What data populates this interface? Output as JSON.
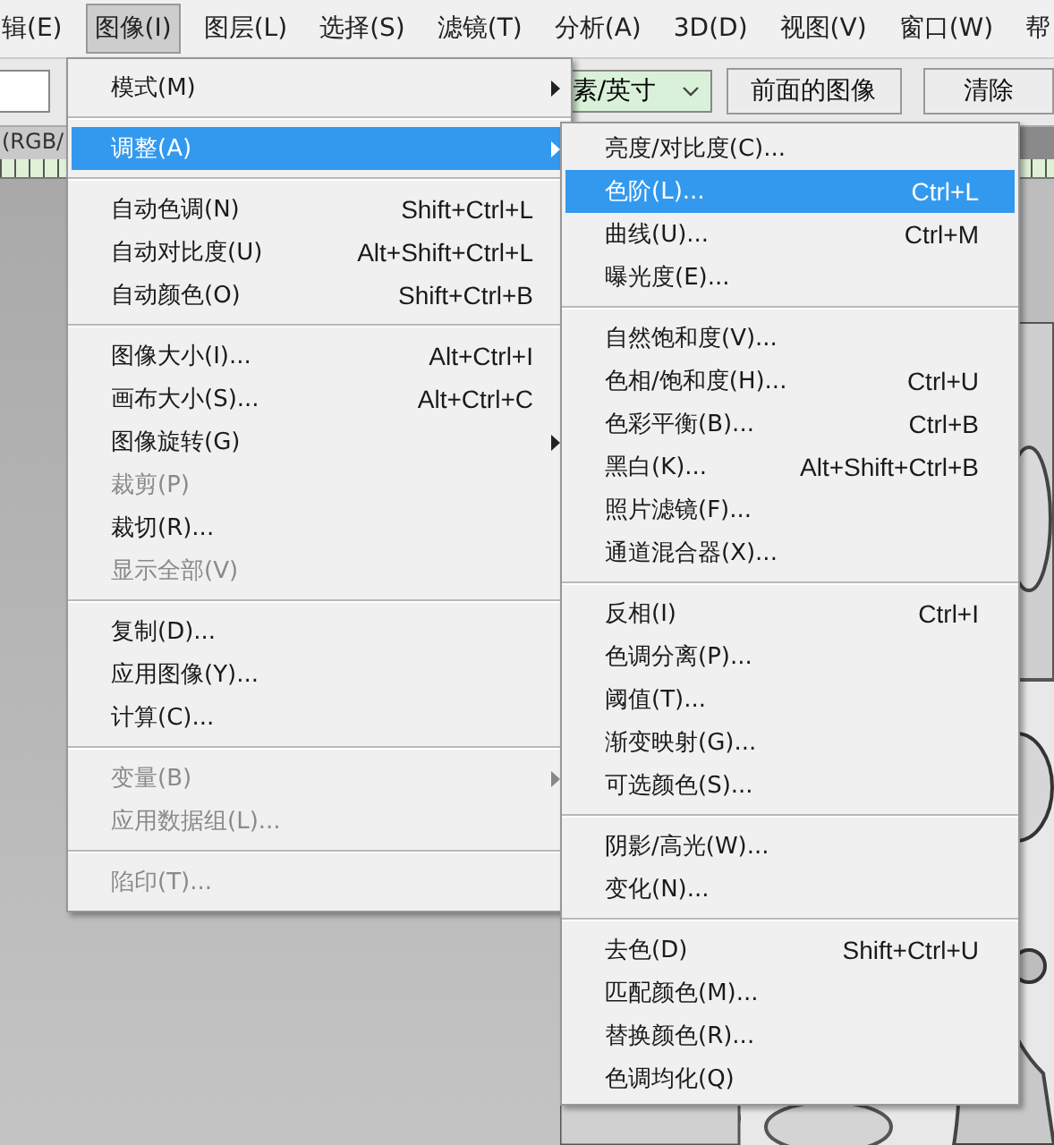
{
  "menubar": [
    {
      "label": "辑(E)",
      "selected": false
    },
    {
      "label": "图像(I)",
      "selected": true
    },
    {
      "label": "图层(L)",
      "selected": false
    },
    {
      "label": "选择(S)",
      "selected": false
    },
    {
      "label": "滤镜(T)",
      "selected": false
    },
    {
      "label": "分析(A)",
      "selected": false
    },
    {
      "label": "3D(D)",
      "selected": false
    },
    {
      "label": "视图(V)",
      "selected": false
    },
    {
      "label": "窗口(W)",
      "selected": false
    },
    {
      "label": "帮",
      "selected": false
    }
  ],
  "toolbar": {
    "units_select": "素/英寸",
    "buttons": [
      "前面的图像",
      "清除"
    ]
  },
  "document_tab": "(RGB/",
  "image_menu": [
    {
      "kind": "item",
      "label": "模式(M)",
      "has_submenu": true,
      "disabled": false,
      "selected": false
    },
    {
      "kind": "separator"
    },
    {
      "kind": "item",
      "label": "调整(A)",
      "has_submenu": true,
      "disabled": false,
      "selected": true
    },
    {
      "kind": "separator"
    },
    {
      "kind": "item",
      "label": "自动色调(N)",
      "shortcut": "Shift+Ctrl+L",
      "has_submenu": false,
      "disabled": false,
      "selected": false
    },
    {
      "kind": "item",
      "label": "自动对比度(U)",
      "shortcut": "Alt+Shift+Ctrl+L",
      "has_submenu": false,
      "disabled": false,
      "selected": false
    },
    {
      "kind": "item",
      "label": "自动颜色(O)",
      "shortcut": "Shift+Ctrl+B",
      "has_submenu": false,
      "disabled": false,
      "selected": false
    },
    {
      "kind": "separator"
    },
    {
      "kind": "item",
      "label": "图像大小(I)...",
      "shortcut": "Alt+Ctrl+I",
      "has_submenu": false,
      "disabled": false,
      "selected": false
    },
    {
      "kind": "item",
      "label": "画布大小(S)...",
      "shortcut": "Alt+Ctrl+C",
      "has_submenu": false,
      "disabled": false,
      "selected": false
    },
    {
      "kind": "item",
      "label": "图像旋转(G)",
      "has_submenu": true,
      "disabled": false,
      "selected": false
    },
    {
      "kind": "item",
      "label": "裁剪(P)",
      "has_submenu": false,
      "disabled": true,
      "selected": false
    },
    {
      "kind": "item",
      "label": "裁切(R)...",
      "has_submenu": false,
      "disabled": false,
      "selected": false
    },
    {
      "kind": "item",
      "label": "显示全部(V)",
      "has_submenu": false,
      "disabled": true,
      "selected": false
    },
    {
      "kind": "separator"
    },
    {
      "kind": "item",
      "label": "复制(D)...",
      "has_submenu": false,
      "disabled": false,
      "selected": false
    },
    {
      "kind": "item",
      "label": "应用图像(Y)...",
      "has_submenu": false,
      "disabled": false,
      "selected": false
    },
    {
      "kind": "item",
      "label": "计算(C)...",
      "has_submenu": false,
      "disabled": false,
      "selected": false
    },
    {
      "kind": "separator"
    },
    {
      "kind": "item",
      "label": "变量(B)",
      "has_submenu": true,
      "disabled": true,
      "selected": false
    },
    {
      "kind": "item",
      "label": "应用数据组(L)...",
      "has_submenu": false,
      "disabled": true,
      "selected": false
    },
    {
      "kind": "separator"
    },
    {
      "kind": "item",
      "label": "陷印(T)...",
      "has_submenu": false,
      "disabled": true,
      "selected": false
    }
  ],
  "adjust_submenu": [
    {
      "kind": "item",
      "label": "亮度/对比度(C)...",
      "selected": false
    },
    {
      "kind": "item",
      "label": "色阶(L)...",
      "shortcut": "Ctrl+L",
      "selected": true
    },
    {
      "kind": "item",
      "label": "曲线(U)...",
      "shortcut": "Ctrl+M",
      "selected": false
    },
    {
      "kind": "item",
      "label": "曝光度(E)...",
      "selected": false
    },
    {
      "kind": "separator"
    },
    {
      "kind": "item",
      "label": "自然饱和度(V)...",
      "selected": false
    },
    {
      "kind": "item",
      "label": "色相/饱和度(H)...",
      "shortcut": "Ctrl+U",
      "selected": false
    },
    {
      "kind": "item",
      "label": "色彩平衡(B)...",
      "shortcut": "Ctrl+B",
      "selected": false
    },
    {
      "kind": "item",
      "label": "黑白(K)...",
      "shortcut": "Alt+Shift+Ctrl+B",
      "selected": false
    },
    {
      "kind": "item",
      "label": "照片滤镜(F)...",
      "selected": false
    },
    {
      "kind": "item",
      "label": "通道混合器(X)...",
      "selected": false
    },
    {
      "kind": "separator"
    },
    {
      "kind": "item",
      "label": "反相(I)",
      "shortcut": "Ctrl+I",
      "selected": false
    },
    {
      "kind": "item",
      "label": "色调分离(P)...",
      "selected": false
    },
    {
      "kind": "item",
      "label": "阈值(T)...",
      "selected": false
    },
    {
      "kind": "item",
      "label": "渐变映射(G)...",
      "selected": false
    },
    {
      "kind": "item",
      "label": "可选颜色(S)...",
      "selected": false
    },
    {
      "kind": "separator"
    },
    {
      "kind": "item",
      "label": "阴影/高光(W)...",
      "selected": false
    },
    {
      "kind": "item",
      "label": "变化(N)...",
      "selected": false
    },
    {
      "kind": "separator"
    },
    {
      "kind": "item",
      "label": "去色(D)",
      "shortcut": "Shift+Ctrl+U",
      "selected": false
    },
    {
      "kind": "item",
      "label": "匹配颜色(M)...",
      "selected": false
    },
    {
      "kind": "item",
      "label": "替换颜色(R)...",
      "selected": false
    },
    {
      "kind": "item",
      "label": "色调均化(Q)",
      "selected": false
    }
  ]
}
